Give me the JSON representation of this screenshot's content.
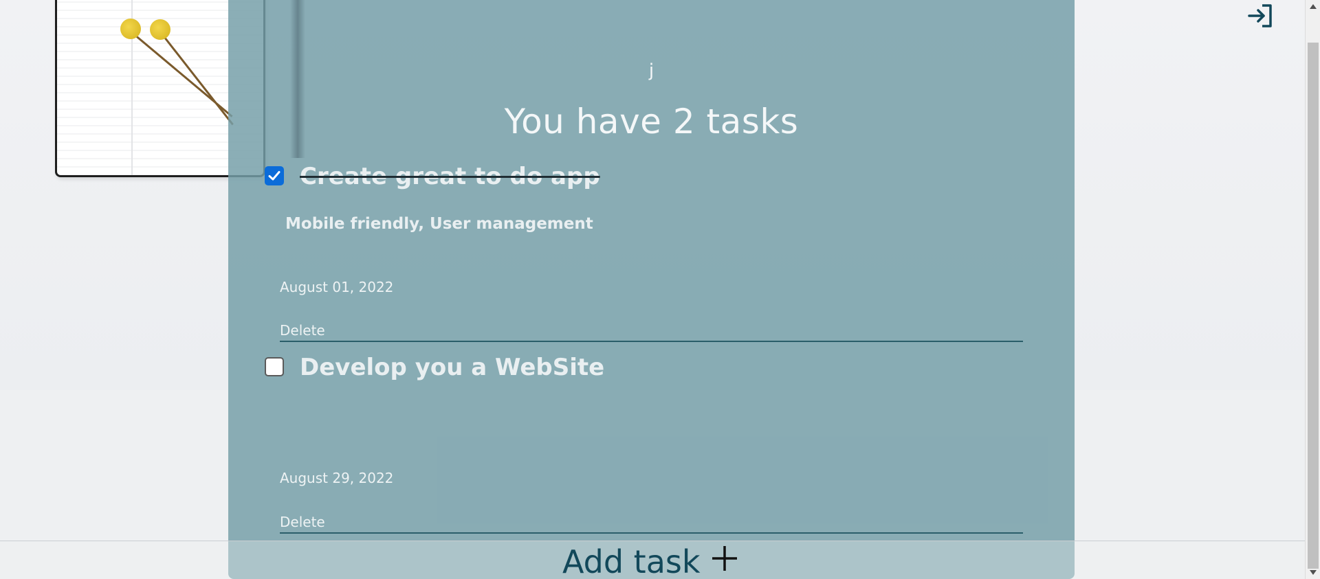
{
  "header": {
    "username": "j",
    "tasks_summary": "You have 2 tasks"
  },
  "tasks": [
    {
      "title": "Create great to do app",
      "description": "Mobile friendly, User management",
      "date": "August 01, 2022",
      "delete_label": "Delete",
      "completed": true
    },
    {
      "title": "Develop you a WebSite",
      "description": "",
      "date": "August 29, 2022",
      "delete_label": "Delete",
      "completed": false
    }
  ],
  "footer": {
    "add_task_label": "Add task",
    "add_icon": "plus-icon"
  },
  "toolbar": {
    "logout_icon": "sign-in-arrow-icon"
  },
  "colors": {
    "card_overlay": "#759ea8",
    "checkbox_checked": "#0b6cd9",
    "accent_dark": "#12485a"
  }
}
